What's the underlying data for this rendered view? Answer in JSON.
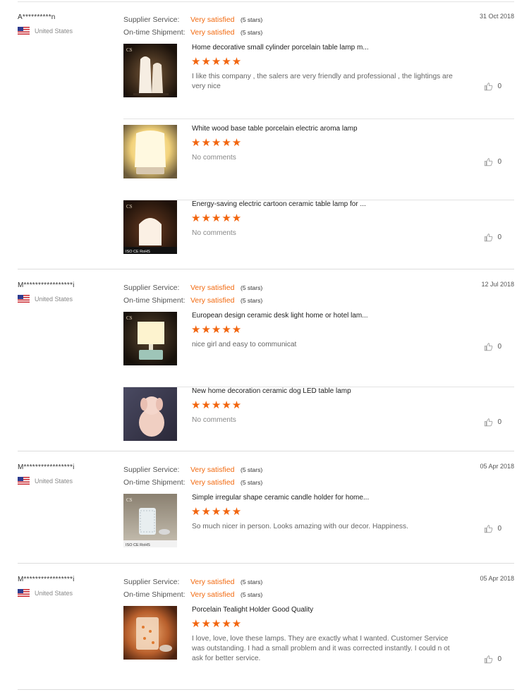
{
  "labels": {
    "supplier_service": "Supplier Service:",
    "ontime_shipment": "On-time Shipment:"
  },
  "reviews": [
    {
      "buyer": "A**********n",
      "country": "United States",
      "date": "31 Oct 2018",
      "supplier_value": "Very satisfied",
      "supplier_stars": "(5 stars)",
      "shipment_value": "Very satisfied",
      "shipment_stars": "(5 stars)",
      "items": [
        {
          "title": "Home decorative small cylinder porcelain table lamp m...",
          "rating": 5,
          "comment": "I like this company , the salers are very friendly and professional , the lightings are very nice",
          "likes": "0"
        },
        {
          "title": "White wood base table porcelain electric aroma lamp",
          "rating": 5,
          "comment": "No comments",
          "likes": "0"
        },
        {
          "title": "Energy-saving electric cartoon ceramic table lamp for ...",
          "rating": 5,
          "comment": "No comments",
          "likes": "0"
        }
      ]
    },
    {
      "buyer": "M*****************i",
      "country": "United States",
      "date": "12 Jul 2018",
      "supplier_value": "Very satisfied",
      "supplier_stars": "(5 stars)",
      "shipment_value": "Very satisfied",
      "shipment_stars": "(5 stars)",
      "items": [
        {
          "title": "European design ceramic desk light home or hotel lam...",
          "rating": 5,
          "comment": "nice girl and easy to communicat",
          "likes": "0"
        },
        {
          "title": "New home decoration ceramic dog LED table lamp",
          "rating": 5,
          "comment": "No comments",
          "likes": "0"
        }
      ]
    },
    {
      "buyer": "M*****************i",
      "country": "United States",
      "date": "05 Apr 2018",
      "supplier_value": "Very satisfied",
      "supplier_stars": "(5 stars)",
      "shipment_value": "Very satisfied",
      "shipment_stars": "(5 stars)",
      "items": [
        {
          "title": "Simple irregular shape ceramic candle holder for home...",
          "rating": 5,
          "comment": "So much nicer in person. Looks amazing with our decor. Happiness.",
          "likes": "0"
        }
      ]
    },
    {
      "buyer": "M*****************i",
      "country": "United States",
      "date": "05 Apr 2018",
      "supplier_value": "Very satisfied",
      "supplier_stars": "(5 stars)",
      "shipment_value": "Very satisfied",
      "shipment_stars": "(5 stars)",
      "items": [
        {
          "title": "Porcelain Tealight Holder Good Quality",
          "rating": 5,
          "comment": "I love, love, love these lamps. They are exactly what I wanted. Customer Service was outstanding. I had a small problem and it was corrected instantly. I could n ot ask for better service.",
          "likes": "0"
        }
      ]
    }
  ],
  "thumb_logo_text": "CS",
  "thumb_cert_text": "ISO CE RoHS",
  "colors": {
    "accent": "#f26a10",
    "star": "#f2650e",
    "divider": "#dcdcdc"
  }
}
